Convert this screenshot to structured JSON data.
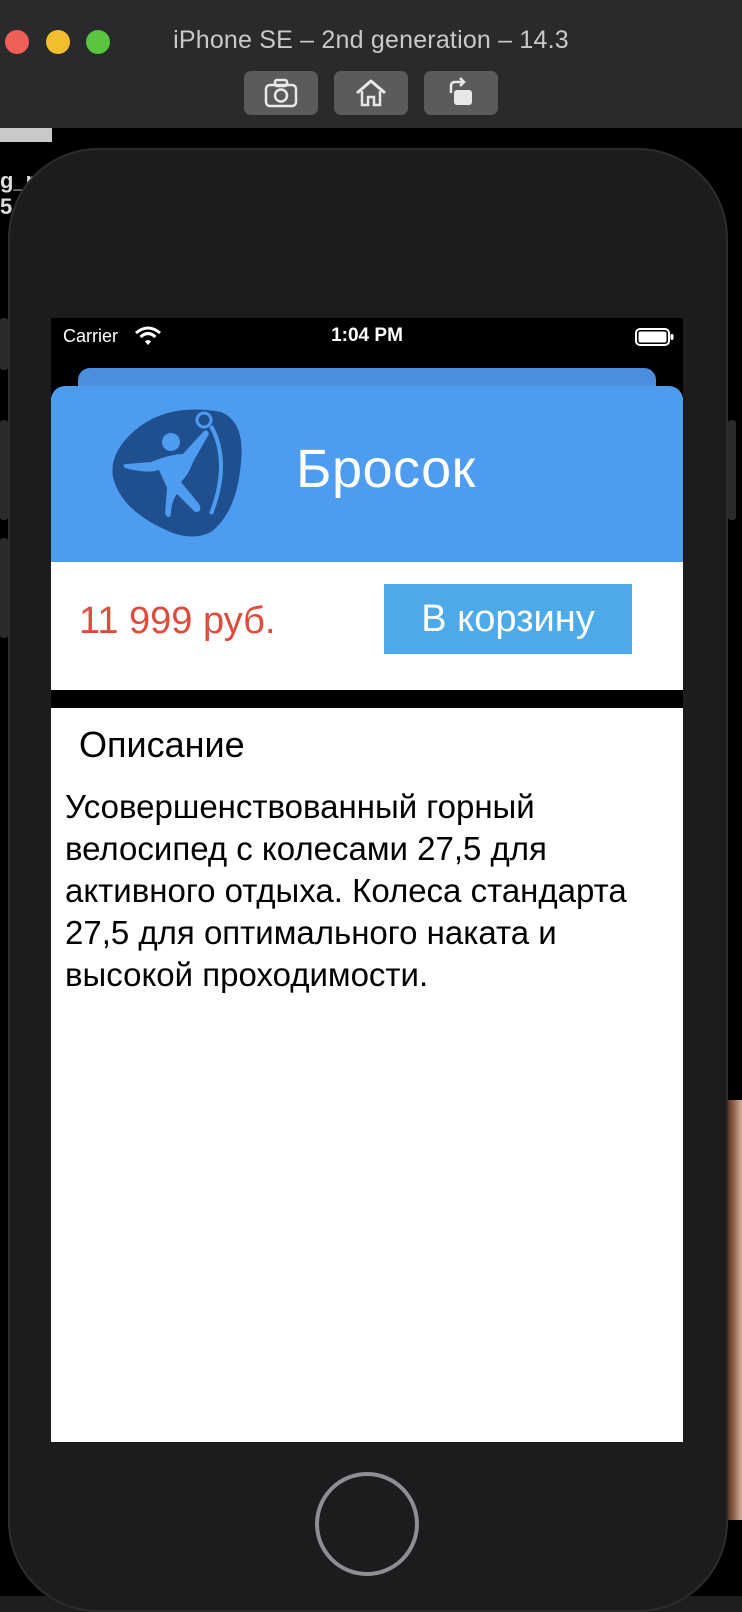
{
  "window": {
    "title": "iPhone SE – 2nd generation – 14.3",
    "toolbar": [
      {
        "name": "screenshot",
        "icon": "camera-icon"
      },
      {
        "name": "home",
        "icon": "home-icon"
      },
      {
        "name": "rotate",
        "icon": "rotate-icon"
      }
    ]
  },
  "desktop": {
    "label_line1": "g_p",
    "label_line2": "5"
  },
  "status_bar": {
    "carrier": "Carrier",
    "time": "1:04 PM"
  },
  "product": {
    "title": "Бросок",
    "price": "11 999 руб.",
    "cart_button_label": "В корзину",
    "description_heading": "Описание",
    "description": "Усовершенствованный горный велосипед с колесами 27,5 для активного отдыха. Колеса стандарта 27,5 для оптимального наката и высокой проходимости."
  },
  "colors": {
    "header_bg": "#4d9cf0",
    "price": "#e04b3d",
    "cart_button": "#4ea9e8",
    "logo": "#1f4f8f"
  }
}
